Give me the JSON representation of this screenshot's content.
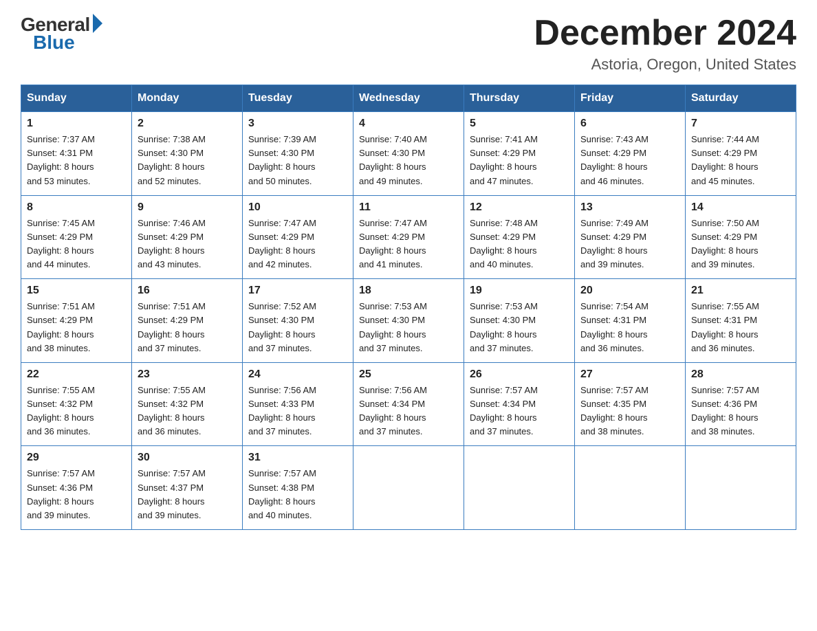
{
  "header": {
    "logo_general": "General",
    "logo_blue": "Blue",
    "month_title": "December 2024",
    "location": "Astoria, Oregon, United States"
  },
  "days_of_week": [
    "Sunday",
    "Monday",
    "Tuesday",
    "Wednesday",
    "Thursday",
    "Friday",
    "Saturday"
  ],
  "weeks": [
    [
      {
        "day": "1",
        "sunrise": "7:37 AM",
        "sunset": "4:31 PM",
        "daylight": "8 hours and 53 minutes."
      },
      {
        "day": "2",
        "sunrise": "7:38 AM",
        "sunset": "4:30 PM",
        "daylight": "8 hours and 52 minutes."
      },
      {
        "day": "3",
        "sunrise": "7:39 AM",
        "sunset": "4:30 PM",
        "daylight": "8 hours and 50 minutes."
      },
      {
        "day": "4",
        "sunrise": "7:40 AM",
        "sunset": "4:30 PM",
        "daylight": "8 hours and 49 minutes."
      },
      {
        "day": "5",
        "sunrise": "7:41 AM",
        "sunset": "4:29 PM",
        "daylight": "8 hours and 47 minutes."
      },
      {
        "day": "6",
        "sunrise": "7:43 AM",
        "sunset": "4:29 PM",
        "daylight": "8 hours and 46 minutes."
      },
      {
        "day": "7",
        "sunrise": "7:44 AM",
        "sunset": "4:29 PM",
        "daylight": "8 hours and 45 minutes."
      }
    ],
    [
      {
        "day": "8",
        "sunrise": "7:45 AM",
        "sunset": "4:29 PM",
        "daylight": "8 hours and 44 minutes."
      },
      {
        "day": "9",
        "sunrise": "7:46 AM",
        "sunset": "4:29 PM",
        "daylight": "8 hours and 43 minutes."
      },
      {
        "day": "10",
        "sunrise": "7:47 AM",
        "sunset": "4:29 PM",
        "daylight": "8 hours and 42 minutes."
      },
      {
        "day": "11",
        "sunrise": "7:47 AM",
        "sunset": "4:29 PM",
        "daylight": "8 hours and 41 minutes."
      },
      {
        "day": "12",
        "sunrise": "7:48 AM",
        "sunset": "4:29 PM",
        "daylight": "8 hours and 40 minutes."
      },
      {
        "day": "13",
        "sunrise": "7:49 AM",
        "sunset": "4:29 PM",
        "daylight": "8 hours and 39 minutes."
      },
      {
        "day": "14",
        "sunrise": "7:50 AM",
        "sunset": "4:29 PM",
        "daylight": "8 hours and 39 minutes."
      }
    ],
    [
      {
        "day": "15",
        "sunrise": "7:51 AM",
        "sunset": "4:29 PM",
        "daylight": "8 hours and 38 minutes."
      },
      {
        "day": "16",
        "sunrise": "7:51 AM",
        "sunset": "4:29 PM",
        "daylight": "8 hours and 37 minutes."
      },
      {
        "day": "17",
        "sunrise": "7:52 AM",
        "sunset": "4:30 PM",
        "daylight": "8 hours and 37 minutes."
      },
      {
        "day": "18",
        "sunrise": "7:53 AM",
        "sunset": "4:30 PM",
        "daylight": "8 hours and 37 minutes."
      },
      {
        "day": "19",
        "sunrise": "7:53 AM",
        "sunset": "4:30 PM",
        "daylight": "8 hours and 37 minutes."
      },
      {
        "day": "20",
        "sunrise": "7:54 AM",
        "sunset": "4:31 PM",
        "daylight": "8 hours and 36 minutes."
      },
      {
        "day": "21",
        "sunrise": "7:55 AM",
        "sunset": "4:31 PM",
        "daylight": "8 hours and 36 minutes."
      }
    ],
    [
      {
        "day": "22",
        "sunrise": "7:55 AM",
        "sunset": "4:32 PM",
        "daylight": "8 hours and 36 minutes."
      },
      {
        "day": "23",
        "sunrise": "7:55 AM",
        "sunset": "4:32 PM",
        "daylight": "8 hours and 36 minutes."
      },
      {
        "day": "24",
        "sunrise": "7:56 AM",
        "sunset": "4:33 PM",
        "daylight": "8 hours and 37 minutes."
      },
      {
        "day": "25",
        "sunrise": "7:56 AM",
        "sunset": "4:34 PM",
        "daylight": "8 hours and 37 minutes."
      },
      {
        "day": "26",
        "sunrise": "7:57 AM",
        "sunset": "4:34 PM",
        "daylight": "8 hours and 37 minutes."
      },
      {
        "day": "27",
        "sunrise": "7:57 AM",
        "sunset": "4:35 PM",
        "daylight": "8 hours and 38 minutes."
      },
      {
        "day": "28",
        "sunrise": "7:57 AM",
        "sunset": "4:36 PM",
        "daylight": "8 hours and 38 minutes."
      }
    ],
    [
      {
        "day": "29",
        "sunrise": "7:57 AM",
        "sunset": "4:36 PM",
        "daylight": "8 hours and 39 minutes."
      },
      {
        "day": "30",
        "sunrise": "7:57 AM",
        "sunset": "4:37 PM",
        "daylight": "8 hours and 39 minutes."
      },
      {
        "day": "31",
        "sunrise": "7:57 AM",
        "sunset": "4:38 PM",
        "daylight": "8 hours and 40 minutes."
      },
      null,
      null,
      null,
      null
    ]
  ],
  "labels": {
    "sunrise_prefix": "Sunrise: ",
    "sunset_prefix": "Sunset: ",
    "daylight_prefix": "Daylight: "
  }
}
